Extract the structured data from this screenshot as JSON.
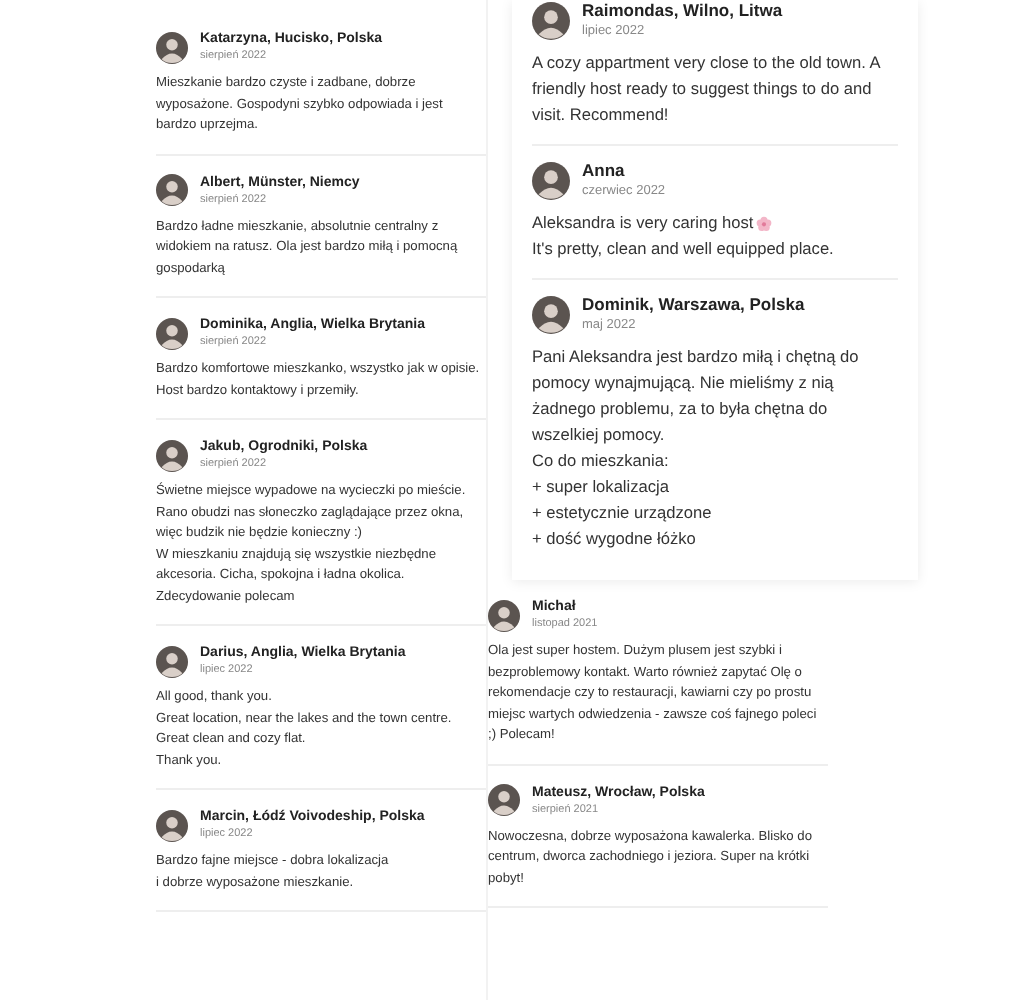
{
  "columns": [
    {
      "panels": [
        {
          "kind": "compact",
          "reviews": [
            {
              "name": "Katarzyna, Hucisko, Polska",
              "date": "sierpień 2022",
              "paragraphs": [
                "Mieszkanie bardzo czyste i zadbane, dobrze wyposażone. Gospodyni szybko odpowiada i jest bardzo uprzejma."
              ]
            },
            {
              "name": "Albert, Münster, Niemcy",
              "date": "sierpień 2022",
              "paragraphs": [
                "Bardzo ładne mieszkanie, absolutnie centralny z widokiem na ratusz. Ola jest bardzo miłą i pomocną gospodarką"
              ]
            },
            {
              "name": "Dominika, Anglia, Wielka Brytania",
              "date": "sierpień 2022",
              "paragraphs": [
                "Bardzo komfortowe mieszkanko, wszystko jak w opisie. Host bardzo kontaktowy i przemiły."
              ]
            },
            {
              "name": "Jakub, Ogrodniki, Polska",
              "date": "sierpień 2022",
              "paragraphs": [
                "Świetne miejsce wypadowe na wycieczki po mieście. Rano obudzi nas słoneczko zaglądające przez okna, więc budzik nie będzie konieczny :)",
                "W mieszkaniu znajdują się wszystkie niezbędne akcesoria. Cicha, spokojna i ładna okolica.",
                "Zdecydowanie polecam"
              ]
            },
            {
              "name": "Darius, Anglia, Wielka Brytania",
              "date": "lipiec 2022",
              "paragraphs": [
                "All good, thank you.",
                "Great location, near the lakes and the town centre.",
                "Great clean and cozy flat.",
                "Thank you."
              ]
            },
            {
              "name": "Marcin, Łódź Voivodeship, Polska",
              "date": "lipiec 2022",
              "paragraphs": [
                "Bardzo fajne miejsce - dobra lokalizacja",
                "i dobrze wyposażone mieszkanie."
              ]
            }
          ]
        }
      ]
    },
    {
      "panels": [
        {
          "kind": "large",
          "reviews": [
            {
              "name": "Raimondas, Wilno, Litwa",
              "date": "lipiec 2022",
              "paragraphs": [
                "A cozy appartment very close to the old town. A friendly host ready to suggest things to do and visit. Recommend!"
              ]
            },
            {
              "name": "Anna",
              "date": "czerwiec 2022",
              "paragraphs": [
                "Aleksandra is very caring host",
                "It's pretty, clean and well equipped place."
              ]
            },
            {
              "name": "Dominik, Warszawa, Polska",
              "date": "maj 2022",
              "paragraphs": [
                "Pani Aleksandra jest bardzo miłą i chętną do pomocy wynajmującą. Nie mieliśmy z nią żadnego problemu, za to była chętna do wszelkiej pomocy.",
                "Co do mieszkania:",
                "+ super lokalizacja",
                "+ estetycznie urządzone",
                "+ dość wygodne łóżko"
              ]
            }
          ]
        },
        {
          "kind": "compact",
          "reviews": [
            {
              "name": "Michał",
              "date": "listopad 2021",
              "paragraphs": [
                "Ola jest super hostem. Dużym plusem jest szybki i bezproblemowy kontakt. Warto również zapytać Olę o rekomendacje czy to restauracji, kawiarni czy po prostu miejsc wartych odwiedzenia - zawsze coś fajnego poleci ;) Polecam!"
              ]
            },
            {
              "name": "Mateusz, Wrocław, Polska",
              "date": "sierpień 2021",
              "paragraphs": [
                "Nowoczesna, dobrze wyposażona kawalerka. Blisko do centrum, dworca zachodniego i jeziora. Super na krótki pobyt!"
              ]
            }
          ]
        }
      ]
    }
  ]
}
